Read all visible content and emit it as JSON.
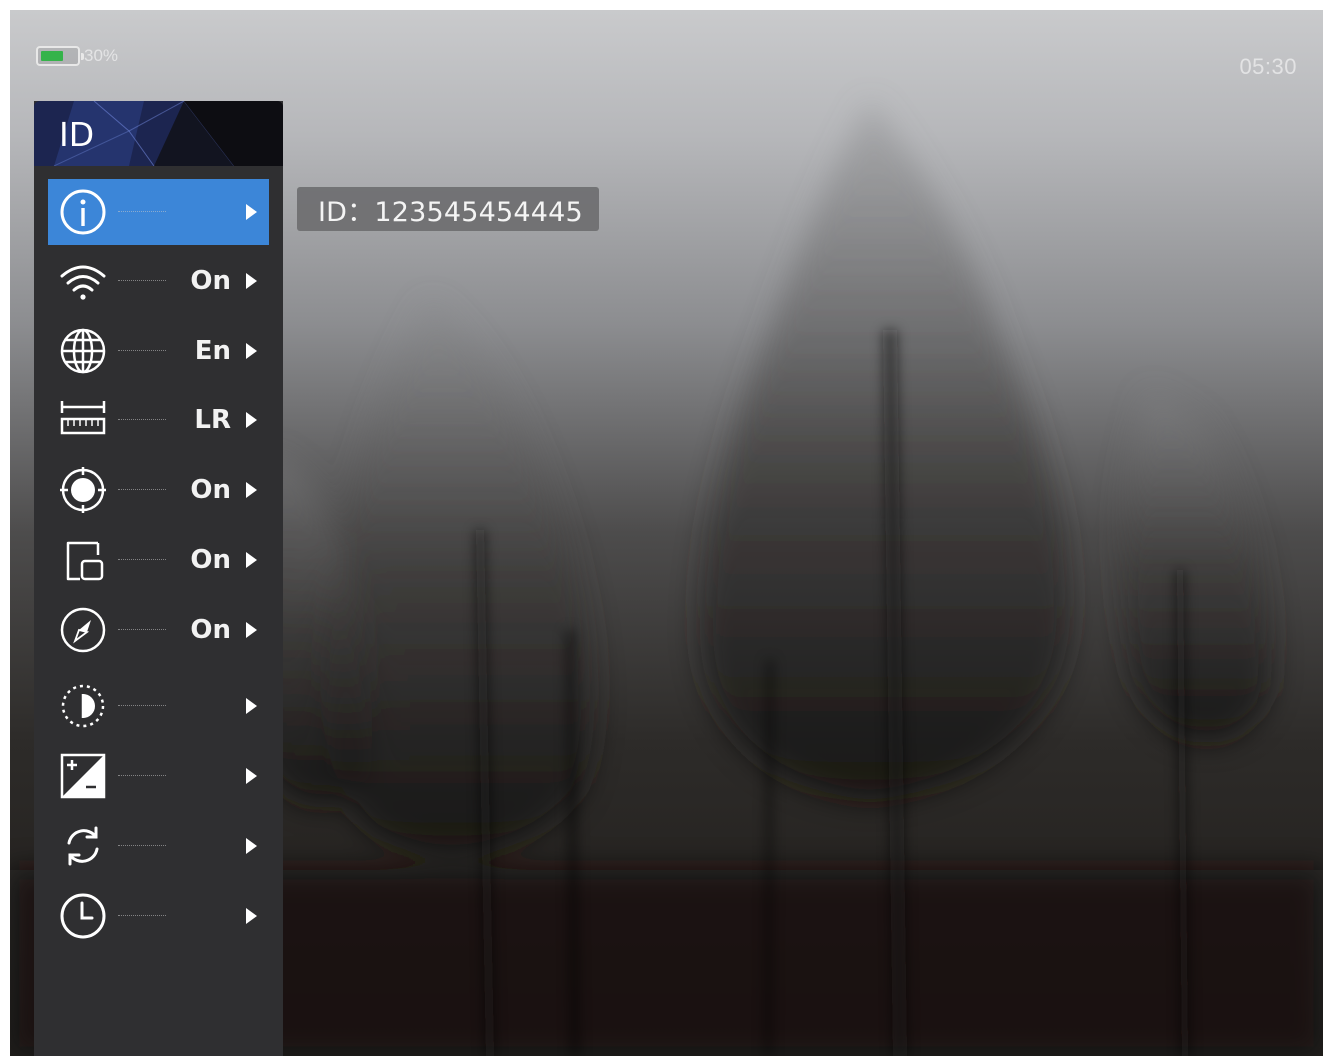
{
  "status": {
    "battery_percent_text": "30%",
    "battery_level": 0.65,
    "battery_color": "#35b34a",
    "time": "05:30"
  },
  "menu": {
    "header_title": "ID",
    "selected_color": "#3c86d8",
    "items": [
      {
        "icon": "info-icon",
        "value": "",
        "selected": true
      },
      {
        "icon": "wifi-icon",
        "value": "On"
      },
      {
        "icon": "globe-icon",
        "value": "En"
      },
      {
        "icon": "ruler-icon",
        "value": "LR"
      },
      {
        "icon": "crosshair-icon",
        "value": "On"
      },
      {
        "icon": "picture-in-picture-icon",
        "value": "On"
      },
      {
        "icon": "compass-icon",
        "value": "On"
      },
      {
        "icon": "contrast-icon",
        "value": ""
      },
      {
        "icon": "exposure-icon",
        "value": ""
      },
      {
        "icon": "refresh-icon",
        "value": ""
      },
      {
        "icon": "clock-icon",
        "value": ""
      }
    ]
  },
  "tooltip": {
    "text": "ID：123545454445"
  }
}
